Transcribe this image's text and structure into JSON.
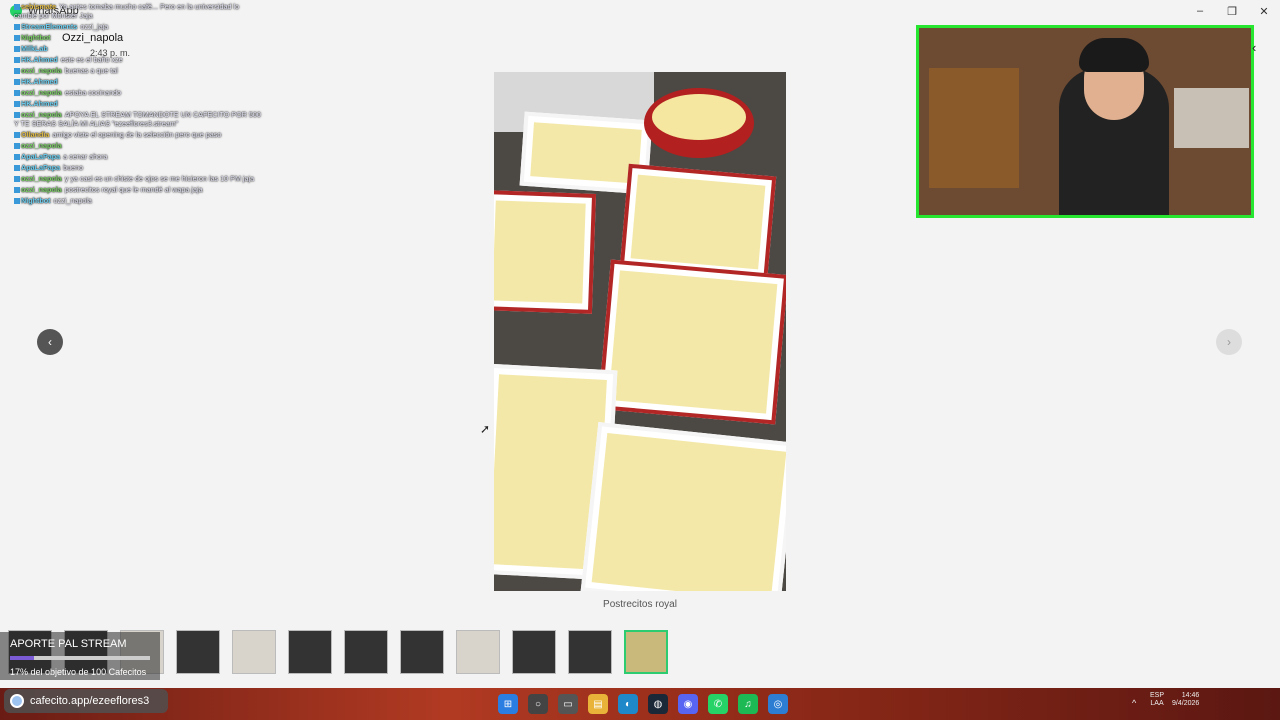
{
  "window": {
    "app_title": "WhatsApp",
    "minimize": "–",
    "maximize": "❐",
    "close": "✕"
  },
  "contact": {
    "name": "Ozzi_napola",
    "time": "2:43 p. m."
  },
  "chat": [
    {
      "user": "sebismate",
      "text": "Yo antes tomaba mucho café... Pero en la universidad lo cambié por Monster Jaja",
      "color": "#e6c04a"
    },
    {
      "user": "StreamElements",
      "text": "ozzi_jaja",
      "color": "#6fd3f5"
    },
    {
      "user": "Nightbot",
      "text": "",
      "color": "#7fd36a"
    },
    {
      "user": "MilkLab",
      "text": "",
      "color": "#6fd3f5"
    },
    {
      "user": "HK.Ahmed",
      "text": "este es el baño xze",
      "color": "#6fd3f5"
    },
    {
      "user": "ozzi_napola",
      "text": "buenas a que tal",
      "color": "#7fd36a"
    },
    {
      "user": "HK.Ahmed",
      "text": "",
      "color": "#6fd3f5"
    },
    {
      "user": "ozzi_napola",
      "text": "estaba cocinando",
      "color": "#7fd36a"
    },
    {
      "user": "HK.Ahmed",
      "text": "",
      "color": "#6fd3f5"
    },
    {
      "user": "ozzi_napola",
      "text": "APOYA EL STREAM TOMANDOTE UN CAFECITO POR 500 Y TE SERAS SALÍA MI ALIAS \"ezeeflores3.stream\"",
      "color": "#7fd36a"
    },
    {
      "user": "Ollandia",
      "text": "amigo viste el opening de la selección pero que paso",
      "color": "#e6c04a"
    },
    {
      "user": "ozzi_napola",
      "text": "",
      "color": "#7fd36a"
    },
    {
      "user": "ApaLaPapa",
      "text": "a cenar ahora",
      "color": "#6fd3f5"
    },
    {
      "user": "ApaLaPapa",
      "text": "bueno",
      "color": "#6fd3f5"
    },
    {
      "user": "ozzi_napola",
      "text": "y ya casi es un chiste de ojos se me hicieron las 10 PM jaja",
      "color": "#7fd36a"
    },
    {
      "user": "ozzi_napola",
      "text": "postrecitos royal que le mandé al wapa jaja",
      "color": "#7fd36a"
    },
    {
      "user": "Nightbot",
      "text": "ozzi_napola",
      "color": "#6fd3f5"
    }
  ],
  "gallery": {
    "caption": "Postrecitos royal",
    "prev": "‹",
    "next": "›",
    "thumbnail_count": 12,
    "active_index": 11
  },
  "webcam": {
    "collapse": "‹"
  },
  "donation": {
    "title": "APORTE PAL STREAM",
    "progress_text": "17% del objetivo de 100 Cafecitos",
    "progress_fraction": 0.17,
    "accent": "#7c5cd6"
  },
  "cafecito": {
    "url": "cafecito.app/ezeeflores3"
  },
  "taskbar": {
    "icons": [
      {
        "name": "windows-start-icon",
        "glyph": "⊞",
        "color": "#2a7de1"
      },
      {
        "name": "search-icon",
        "glyph": "○",
        "color": "#444"
      },
      {
        "name": "task-view-icon",
        "glyph": "▭",
        "color": "#555"
      },
      {
        "name": "file-explorer-icon",
        "glyph": "▤",
        "color": "#e8b338"
      },
      {
        "name": "edge-icon",
        "glyph": "◐",
        "color": "#1e88c8"
      },
      {
        "name": "steam-icon",
        "glyph": "◍",
        "color": "#1b2838"
      },
      {
        "name": "discord-icon",
        "glyph": "◉",
        "color": "#5865f2"
      },
      {
        "name": "whatsapp-icon",
        "glyph": "✆",
        "color": "#25d366"
      },
      {
        "name": "spotify-icon",
        "glyph": "♫",
        "color": "#1db954"
      },
      {
        "name": "app-icon",
        "glyph": "◎",
        "color": "#2d7dd2"
      }
    ],
    "lang_top": "ESP",
    "lang_bottom": "LAA",
    "time": "14:46",
    "date": "9/4/2026",
    "tray_arrow": "^"
  }
}
